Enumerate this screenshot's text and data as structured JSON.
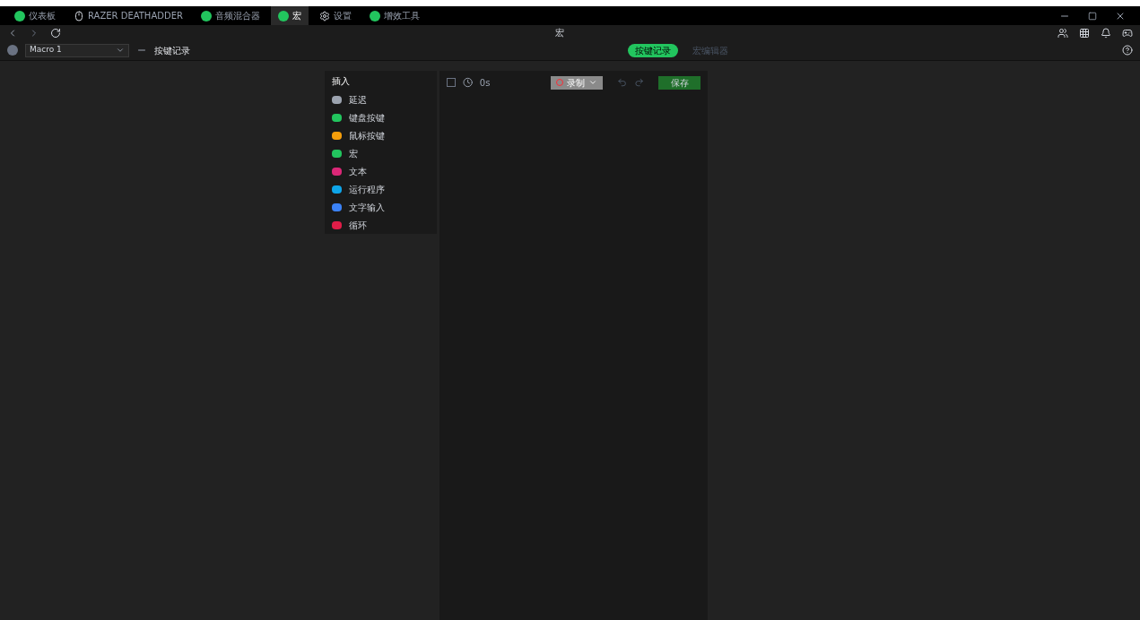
{
  "tabs": [
    {
      "label": "仪表板",
      "selected": false,
      "kind": "circle"
    },
    {
      "label": "RAZER DEATHADDER",
      "selected": false,
      "kind": "mouse"
    },
    {
      "label": "音频混合器",
      "selected": false,
      "kind": "circle"
    },
    {
      "label": "宏",
      "selected": true,
      "kind": "circle"
    },
    {
      "label": "设置",
      "selected": false,
      "kind": "gear"
    },
    {
      "label": "增效工具",
      "selected": false,
      "kind": "circle"
    }
  ],
  "page_title": "宏",
  "macro": {
    "value": "Macro 1"
  },
  "macro_action": "按键记录",
  "modes": [
    {
      "label": "按键记录",
      "selected": true
    },
    {
      "label": "宏编辑器",
      "selected": false
    }
  ],
  "insert": {
    "title": "插入",
    "items": [
      {
        "label": "延迟",
        "color": "#9ca3af"
      },
      {
        "label": "键盘按键",
        "color": "#22c55e"
      },
      {
        "label": "鼠标按键",
        "color": "#f59e0b"
      },
      {
        "label": "宏",
        "color": "#22c55e"
      },
      {
        "label": "文本",
        "color": "#db2777"
      },
      {
        "label": "运行程序",
        "color": "#0ea5e9"
      },
      {
        "label": "文字输入",
        "color": "#3b82f6"
      },
      {
        "label": "循环",
        "color": "#e11d48"
      }
    ]
  },
  "editor": {
    "checked": false,
    "delay": "0s",
    "record": "录制",
    "save": "保存"
  }
}
